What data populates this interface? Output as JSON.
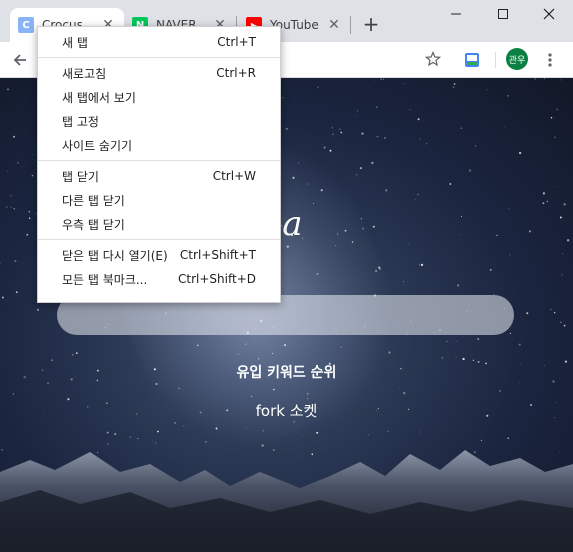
{
  "browser": {
    "tabs": [
      {
        "label": "Crocus",
        "favicon": "C",
        "favicon_color": "#8ab4f8"
      },
      {
        "label": "NAVER",
        "favicon": "N",
        "favicon_color": "#03c75a"
      },
      {
        "label": "YouTube",
        "favicon": "▶",
        "favicon_color": "#ff0000"
      }
    ],
    "new_tab_symbol": "+",
    "profile_avatar": "관우",
    "profile_color": "#0b8043"
  },
  "context_menu": {
    "groups": [
      [
        {
          "label": "새 탭",
          "shortcut": "Ctrl+T"
        }
      ],
      [
        {
          "label": "새로고침",
          "shortcut": "Ctrl+R"
        },
        {
          "label": "새 탭에서 보기",
          "shortcut": ""
        },
        {
          "label": "탭 고정",
          "shortcut": ""
        },
        {
          "label": "사이트 숨기기",
          "shortcut": ""
        }
      ],
      [
        {
          "label": "탭 닫기",
          "shortcut": "Ctrl+W"
        },
        {
          "label": "다른 탭 닫기",
          "shortcut": ""
        },
        {
          "label": "우측 탭 닫기",
          "shortcut": ""
        }
      ],
      [
        {
          "label": "닫은 탭 다시 열기(E)",
          "shortcut": "Ctrl+Shift+T"
        },
        {
          "label": "모든 탭 북마크...",
          "shortcut": "Ctrl+Shift+D"
        }
      ]
    ]
  },
  "page": {
    "logo_partial": "va",
    "trending_title": "유입 키워드 순위",
    "trending_item": "fork 소켓"
  }
}
